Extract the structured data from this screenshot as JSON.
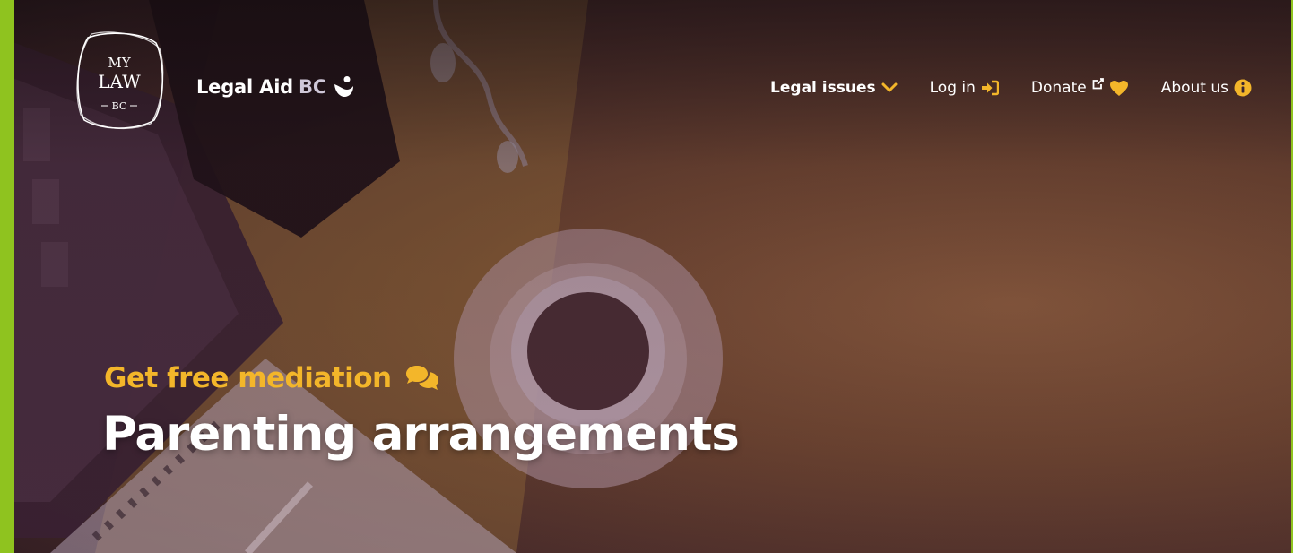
{
  "header": {
    "logo": {
      "line1": "MY",
      "line2": "LAW",
      "line3": "BC"
    },
    "brand_primary": "Legal Aid",
    "brand_secondary": "BC",
    "nav": [
      {
        "label": "Legal issues",
        "icon": "chevron-down-icon"
      },
      {
        "label": "Log in",
        "icon": "sign-in-icon"
      },
      {
        "label": "Donate",
        "icon": "external-link-icon",
        "icon2": "heart-icon"
      },
      {
        "label": "About us",
        "icon": "info-circle-icon"
      }
    ]
  },
  "hero": {
    "kicker": "Get free mediation",
    "kicker_icon": "chat-bubbles-icon",
    "title": "Parenting arrangements"
  },
  "colors": {
    "accent": "#f3b62a",
    "frame": "#8fc31f",
    "text": "#ffffff"
  }
}
